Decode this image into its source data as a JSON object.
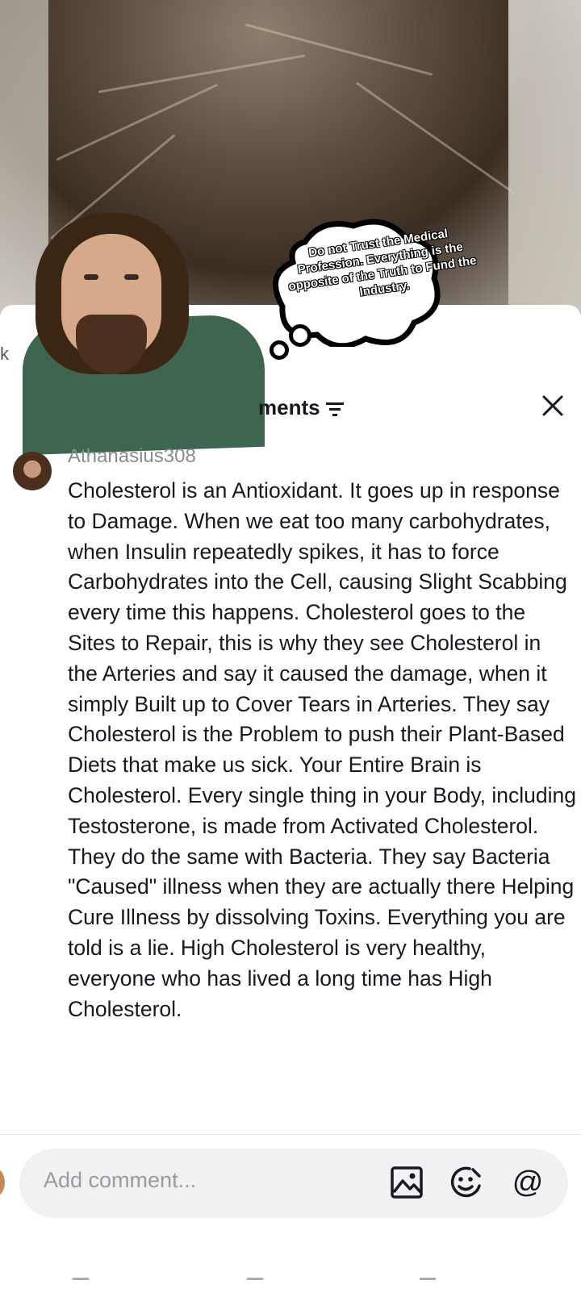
{
  "video": {
    "thought_bubble_text": "Do not Trust the Medical Profession. Everything is the opposite of the Truth to Fund the Industry.",
    "edge_fragment": "k"
  },
  "comments_panel": {
    "title_visible": "ments",
    "filter_icon": "filter-icon",
    "close_icon": "close-icon"
  },
  "comment": {
    "username": "Athanasius308",
    "text": "Cholesterol is an Antioxidant. It goes up in response to Damage. When we eat too many carbohydrates, when Insulin repeatedly spikes, it has to force Carbohydrates into the Cell, causing Slight Scabbing every time this happens. Cholesterol goes to the Sites to Repair, this is why they see Cholesterol in the Arteries and say it caused the damage, when it simply Built up to Cover Tears in Arteries. They say Cholesterol is the Problem to push their Plant-Based Diets that make us sick. Your Entire Brain is Cholesterol. Every single thing in your Body, including Testosterone, is made from Activated Cholesterol. They do the same with Bacteria. They say Bacteria \"Caused\" illness when they are actually there Helping Cure Illness by dissolving Toxins. Everything you are told is a lie. High Cholesterol is very healthy, everyone who has lived a long time has High Cholesterol."
  },
  "composer": {
    "placeholder": "Add comment...",
    "icons": [
      "image-icon",
      "emoji-icon",
      "mention-icon"
    ],
    "mention_glyph": "@"
  }
}
